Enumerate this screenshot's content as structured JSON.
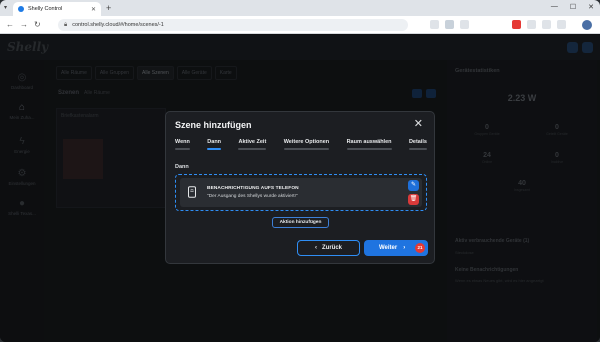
{
  "browser": {
    "tab_title": "Shelly Control",
    "url": "control.shelly.cloud/#/home/scenes/-1"
  },
  "app": {
    "logo": "Shelly",
    "sidebar": [
      {
        "icon": "dashboard-icon",
        "label": "Dashboard"
      },
      {
        "icon": "home-icon",
        "label": "Mein Zuha..."
      },
      {
        "icon": "energy-icon",
        "label": "Energie"
      },
      {
        "icon": "settings-icon",
        "label": "Einstellungen"
      },
      {
        "icon": "user-icon",
        "label": "Shelli Texas..."
      }
    ],
    "subtabs": [
      "Alle Räume",
      "Alle Gruppen",
      "Alle Szenen",
      "Alle Geräte",
      "Karte"
    ],
    "selected_subtab": 2,
    "scenes_title": "Szenen",
    "scenes_filter": "Alle Räume",
    "card_title": "Briefkastenalarm",
    "right_panel": {
      "title": "Gerätestatistiken",
      "power": "2.23 W",
      "stats": [
        {
          "value": "0",
          "label": "Gruppen Geräte"
        },
        {
          "value": "0",
          "label": "Geteilt Geräte"
        },
        {
          "value": "24",
          "label": "Online"
        },
        {
          "value": "0",
          "label": "Inaktive"
        },
        {
          "value": "40",
          "label": "Insgesamt"
        }
      ],
      "top_consumers": "Aktiv verbrauchende Geräte (1)",
      "consumer_row": "Steckdose",
      "notifications": "Keine Benachrichtigungen",
      "notifications_sub": "Wenn es etwas Neues gibt, wird es hier angezeigt"
    }
  },
  "modal": {
    "title": "Szene hinzufügen",
    "steps": [
      "Wenn",
      "Dann",
      "Aktive Zeit",
      "Weitere Optionen",
      "Raum auswählen",
      "Details"
    ],
    "active_step": 1,
    "section_label": "Dann",
    "action": {
      "icon": "phone-notification-icon",
      "title": "BENACHRICHTIGUNG AUFS TELEFON",
      "description": "\"Der Ausgang des Shellys wurde aktiviert!\""
    },
    "add_action_label": "Aktion hinzufügen",
    "back_label": "Zurück",
    "next_label": "Weiter",
    "badge": "21"
  },
  "colors": {
    "accent": "#1f74e0",
    "danger": "#d93a3a",
    "modal_bg": "#1c1e22"
  }
}
